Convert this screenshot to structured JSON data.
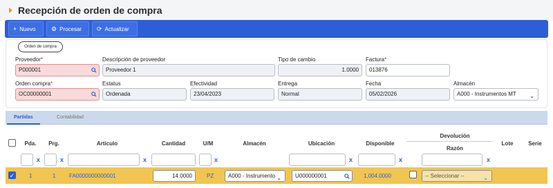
{
  "title": "Recepción de orden de compra",
  "toolbar": {
    "nuevo": "Nuevo",
    "procesar": "Procesar",
    "actualizar": "Actualizar"
  },
  "section_pill": "Orden de compra",
  "form": {
    "proveedor_label": "Proveedor",
    "proveedor_value": "P000001",
    "desc_proveedor_label": "Descripción de proveedor",
    "desc_proveedor_value": "Proveedor 1",
    "tipo_cambio_label": "Tipo de cambio",
    "tipo_cambio_value": "1.0000",
    "factura_label": "Factura",
    "factura_value": "013876",
    "orden_compra_label": "Orden compra",
    "orden_compra_value": "OC00000001",
    "estatus_label": "Estatus",
    "estatus_value": "Ordenada",
    "efectividad_label": "Efectividad",
    "efectividad_value": "23/04/2023",
    "entrega_label": "Entrega",
    "entrega_value": "Normal",
    "fecha_label": "Fecha",
    "fecha_value": "05/02/2026",
    "almacen_label": "Almacén",
    "almacen_value": "A000 - Instrumentos MT",
    "required_mark": "*"
  },
  "tabs": {
    "partidas": "Partidas",
    "contabilidad": "Contabilidad"
  },
  "table": {
    "headers": {
      "pda": "Pda.",
      "prg": "Prg.",
      "articulo": "Artículo",
      "cantidad": "Cantidad",
      "um": "U/M",
      "almacen": "Almacén",
      "ubicacion": "Ubicación",
      "disponible": "Disponible",
      "devolucion": "Devolución",
      "razon": "Razón",
      "lote": "Lote",
      "serie": "Serie"
    },
    "clear_mark": "x",
    "row": {
      "pda": "1",
      "prg": "1",
      "articulo": "FA0000000000001",
      "cantidad": "14.0000",
      "um": "PZ",
      "almacen": "A000 - Instrumento",
      "ubicacion": "U000000001",
      "disponible": "1,004.0000",
      "razon": "-- Seleccionar --"
    }
  }
}
